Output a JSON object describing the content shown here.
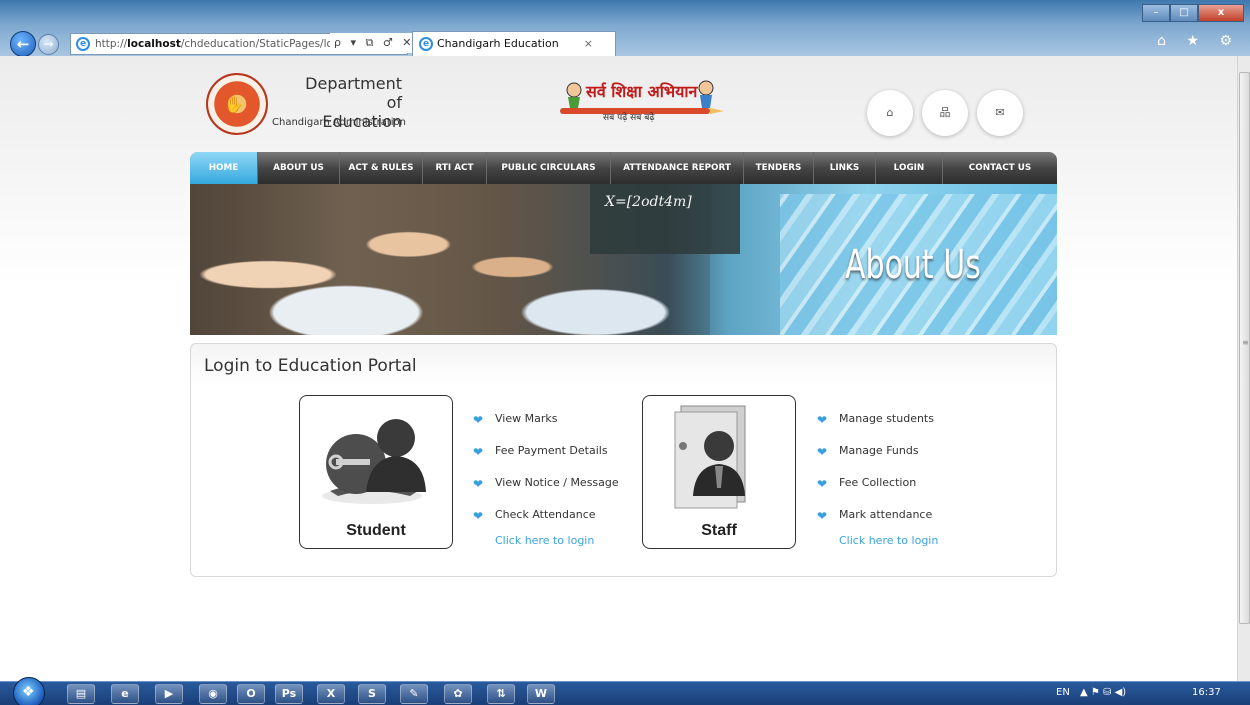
{
  "browser": {
    "url_prefix": "http://",
    "url_host": "localhost",
    "url_path": "/chdeducation/StaticPages/logi",
    "url_tools": "ρ ▾ ⧉ ♂ ✕",
    "tab_title": "Chandigarh Education",
    "tab_close": "×",
    "win_min": "–",
    "win_max": "□",
    "win_close": "x",
    "right_icons": "⌂ ★ ⚙"
  },
  "header": {
    "dept_line1": "Department of",
    "dept_line2": "Education",
    "dept_sub": "Chandigarh Administration",
    "ssa_title": "सर्व शिक्षा अभियान",
    "ssa_sub": "सब पढ़े सब बढ़े",
    "icons": [
      "home-icon",
      "sitemap-icon",
      "mail-icon"
    ]
  },
  "menu": {
    "items": [
      "HOME",
      "ABOUT US",
      "ACT & RULES",
      "RTI ACT",
      "PUBLIC CIRCULARS",
      "ATTENDANCE REPORT",
      "TENDERS",
      "LINKS",
      "LOGIN",
      "CONTACT US"
    ],
    "active": "HOME"
  },
  "banner": {
    "chalk_text": "X=[2odt4m]",
    "title": "About Us"
  },
  "login": {
    "title": "Login to Education Portal",
    "student": {
      "label": "Student",
      "features": [
        "View Marks",
        "Fee Payment Details",
        "View Notice / Message",
        "Check Attendance"
      ],
      "link": "Click here to login"
    },
    "staff": {
      "label": "Staff",
      "features": [
        "Manage students",
        "Manage Funds",
        "Fee Collection",
        "Mark attendance"
      ],
      "link": "Click here to login"
    }
  },
  "taskbar": {
    "apps": [
      "explorer",
      "internet-explorer",
      "media-player",
      "firefox",
      "opera",
      "photoshop",
      "excel",
      "skype",
      "tools",
      "paint",
      "network",
      "word"
    ],
    "app_glyphs": [
      "▤",
      "e",
      "▶",
      "◉",
      "O",
      "Ps",
      "X",
      "S",
      "✎",
      "✿",
      "⇅",
      "W"
    ],
    "lang": "EN",
    "tray_glyphs": "▲  ⚑  ⛁  ◀)",
    "time": "16:37"
  },
  "colors": {
    "menu_active": "#36a8dd",
    "link": "#3aa3e0",
    "check": "#3a9fe0"
  }
}
